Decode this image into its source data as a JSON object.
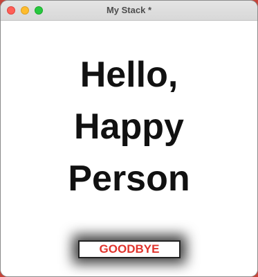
{
  "window": {
    "title": "My Stack *"
  },
  "content": {
    "greeting_lines": [
      "Hello,",
      "Happy",
      "Person"
    ]
  },
  "buttons": {
    "goodbye_label": "GOODBYE"
  },
  "colors": {
    "button_text": "#e0332c",
    "greeting_text": "#111111",
    "close_light": "#ff5f57",
    "minimize_light": "#febc2e",
    "zoom_light": "#28c840"
  }
}
